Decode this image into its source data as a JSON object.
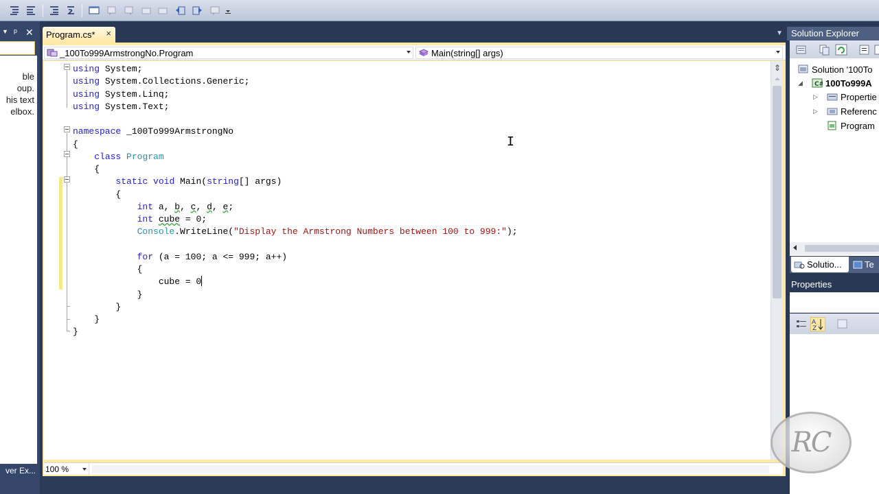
{
  "toolbar": {
    "icons": [
      "comment-lines-icon",
      "uncomment-lines-icon",
      "decrease-indent-icon",
      "increase-indent-icon",
      "toggle-window-icon",
      "previous-bookmark-icon",
      "next-bookmark-icon",
      "previous-bookmark-folder-icon",
      "next-bookmark-folder-icon",
      "previous-bookmark-document-icon",
      "next-bookmark-document-icon",
      "clear-bookmarks-icon",
      "toolbar-options-icon"
    ]
  },
  "toolbox": {
    "text_lines": [
      "ble",
      "oup.",
      "his text",
      "elbox."
    ],
    "footer_label": "ver Ex..."
  },
  "editor": {
    "tab_label": "Program.cs*",
    "tab_close": "×",
    "type_combo": "_100To999ArmstrongNo.Program",
    "member_combo": "Main(string[] args)",
    "zoom": "100 %",
    "code": {
      "l1_kw": "using",
      "l1_rest": " System;",
      "l2_kw": "using",
      "l2_rest": " System.Collections.Generic;",
      "l3_kw": "using",
      "l3_rest": " System.Linq;",
      "l4_kw": "using",
      "l4_rest": " System.Text;",
      "l6_kw": "namespace",
      "l6_rest": " _100To999ArmstrongNo",
      "l7": "{",
      "l8_indent": "    ",
      "l8_kw": "class",
      "l8_ty": " Program",
      "l9": "    {",
      "l10_indent": "        ",
      "l10_kw1": "static",
      "l10_kw2": " void",
      "l10_rest1": " Main(",
      "l10_kw3": "string",
      "l10_rest2": "[] args)",
      "l11": "        {",
      "l12_indent": "            ",
      "l12_kw": "int",
      "l12_a": " a, ",
      "l12_b": "b",
      "l12_c1": ", ",
      "l12_c": "c",
      "l12_d1": ", ",
      "l12_d": "d",
      "l12_e1": ", ",
      "l12_e": "e",
      "l12_end": ";",
      "l13_indent": "            ",
      "l13_kw": "int",
      "l13_sp": " ",
      "l13_cube": "cube",
      "l13_rest": " = 0;",
      "l14_indent": "            ",
      "l14_ty": "Console",
      "l14_rest1": ".WriteLine(",
      "l14_str": "\"Display the Armstrong Numbers between 100 to 999:\"",
      "l14_rest2": ");",
      "l16_indent": "            ",
      "l16_kw": "for",
      "l16_rest": " (a = 100; a <= 999; a++)",
      "l17": "            {",
      "l18": "                cube = 0",
      "l19": "            }",
      "l20": "        }",
      "l21": "    }",
      "l22": "}"
    }
  },
  "solution_explorer": {
    "title": "Solution Explorer",
    "items": [
      {
        "label": "Solution '100To"
      },
      {
        "label": "100To999A"
      },
      {
        "label": "Propertie"
      },
      {
        "label": "Referenc"
      },
      {
        "label": "Program"
      }
    ],
    "tab_solution": "Solutio...",
    "tab_team": "Te"
  },
  "properties": {
    "title": "Properties"
  },
  "watermark": {
    "text": "RC"
  },
  "colors": {
    "keyword": "#1e1edc",
    "type": "#2b91af",
    "string": "#a31515",
    "active_tab": "#ffe8a6",
    "chrome": "#293955"
  }
}
